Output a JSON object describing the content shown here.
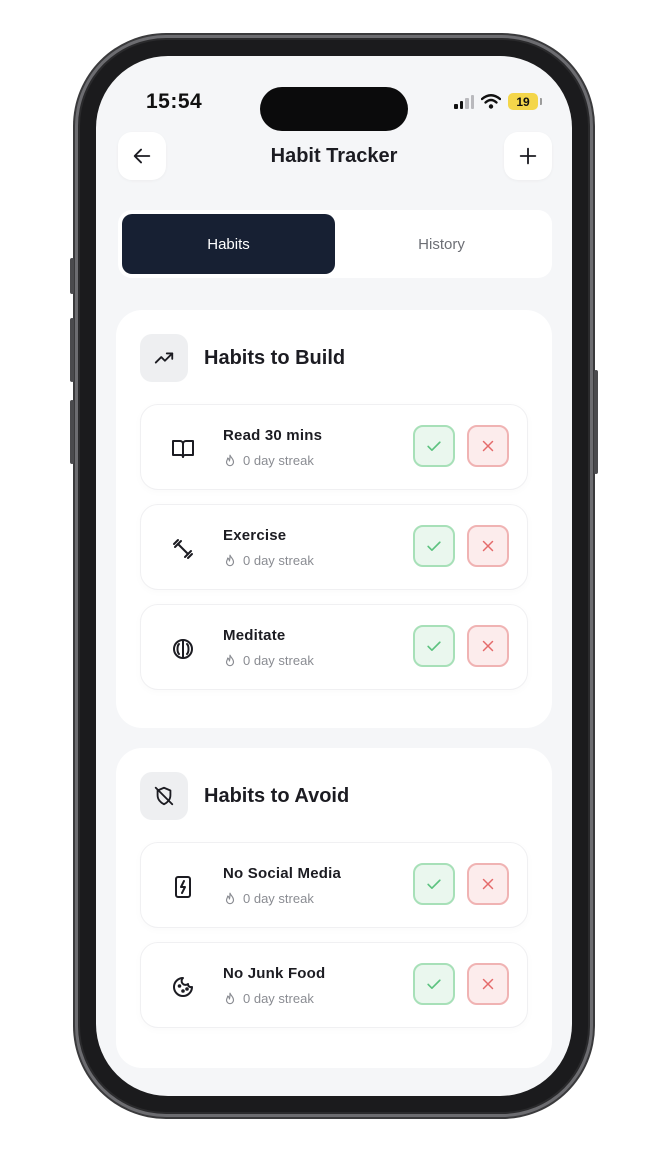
{
  "status_bar": {
    "time": "15:54",
    "battery": "19"
  },
  "header": {
    "title": "Habit Tracker",
    "back_icon": "arrow-left-icon",
    "add_icon": "plus-icon"
  },
  "tabs": [
    {
      "label": "Habits",
      "active": true
    },
    {
      "label": "History",
      "active": false
    }
  ],
  "sections": {
    "build": {
      "title": "Habits to Build",
      "icon": "trending-up-icon",
      "items": [
        {
          "name": "Read 30 mins",
          "icon": "book-icon",
          "streak": "0 day streak"
        },
        {
          "name": "Exercise",
          "icon": "dumbbell-icon",
          "streak": "0 day streak"
        },
        {
          "name": "Meditate",
          "icon": "brain-icon",
          "streak": "0 day streak"
        }
      ]
    },
    "avoid": {
      "title": "Habits to Avoid",
      "icon": "shield-off-icon",
      "items": [
        {
          "name": "No Social Media",
          "icon": "phone-bolt-icon",
          "streak": "0 day streak"
        },
        {
          "name": "No Junk Food",
          "icon": "cookie-icon",
          "streak": "0 day streak"
        }
      ]
    }
  },
  "colors": {
    "active_tab": "#172033",
    "check_bg": "#eaf7ee",
    "check_border": "#a7e0b8",
    "check_icon": "#5cc27f",
    "cross_bg": "#fcecec",
    "cross_border": "#f0b3b3",
    "cross_icon": "#e46a6a"
  }
}
